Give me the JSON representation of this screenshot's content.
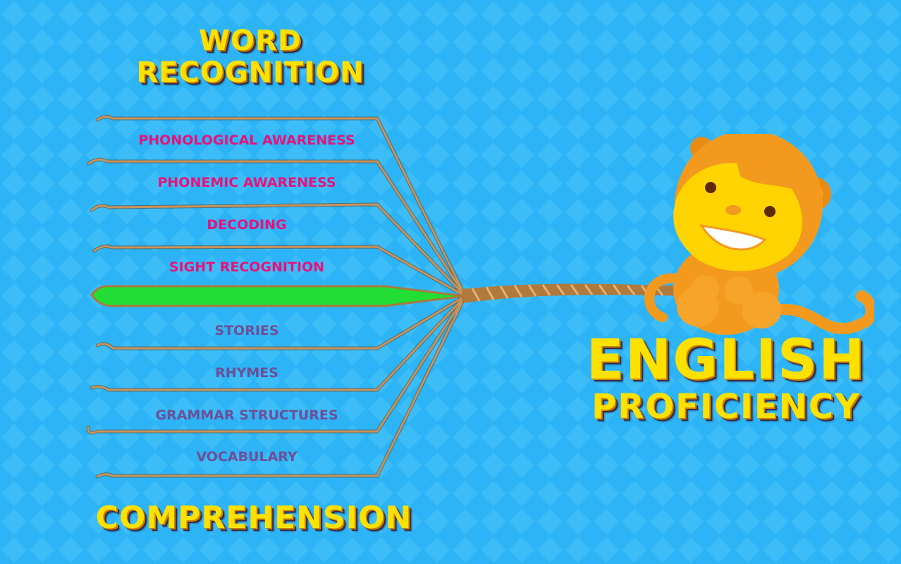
{
  "title_word_recognition": "WORD RECOGNITION",
  "title_comprehension": "COMPREHENSION",
  "title_english": "ENGLISH",
  "title_proficiency": "PROFICIENCY",
  "word_recognition_strands": [
    "PHONOLOGICAL AWARENESS",
    "PHONEMIC AWARENESS",
    "DECODING",
    "SIGHT RECOGNITION"
  ],
  "comprehension_strands": [
    "STORIES",
    "RHYMES",
    "GRAMMAR STRUCTURES",
    "VOCABULARY"
  ],
  "colors": {
    "background": "#2db4f6",
    "title_yellow": "#ffe100",
    "word_recognition_label": "#e8127a",
    "comprehension_label": "#6e4f96",
    "rope": "#b07a3c",
    "highlight_strand": "#22dd33",
    "monkey_orange": "#f39a1e",
    "monkey_face": "#ffd400"
  },
  "icons": [
    "monkey-mascot",
    "rope-strands"
  ]
}
